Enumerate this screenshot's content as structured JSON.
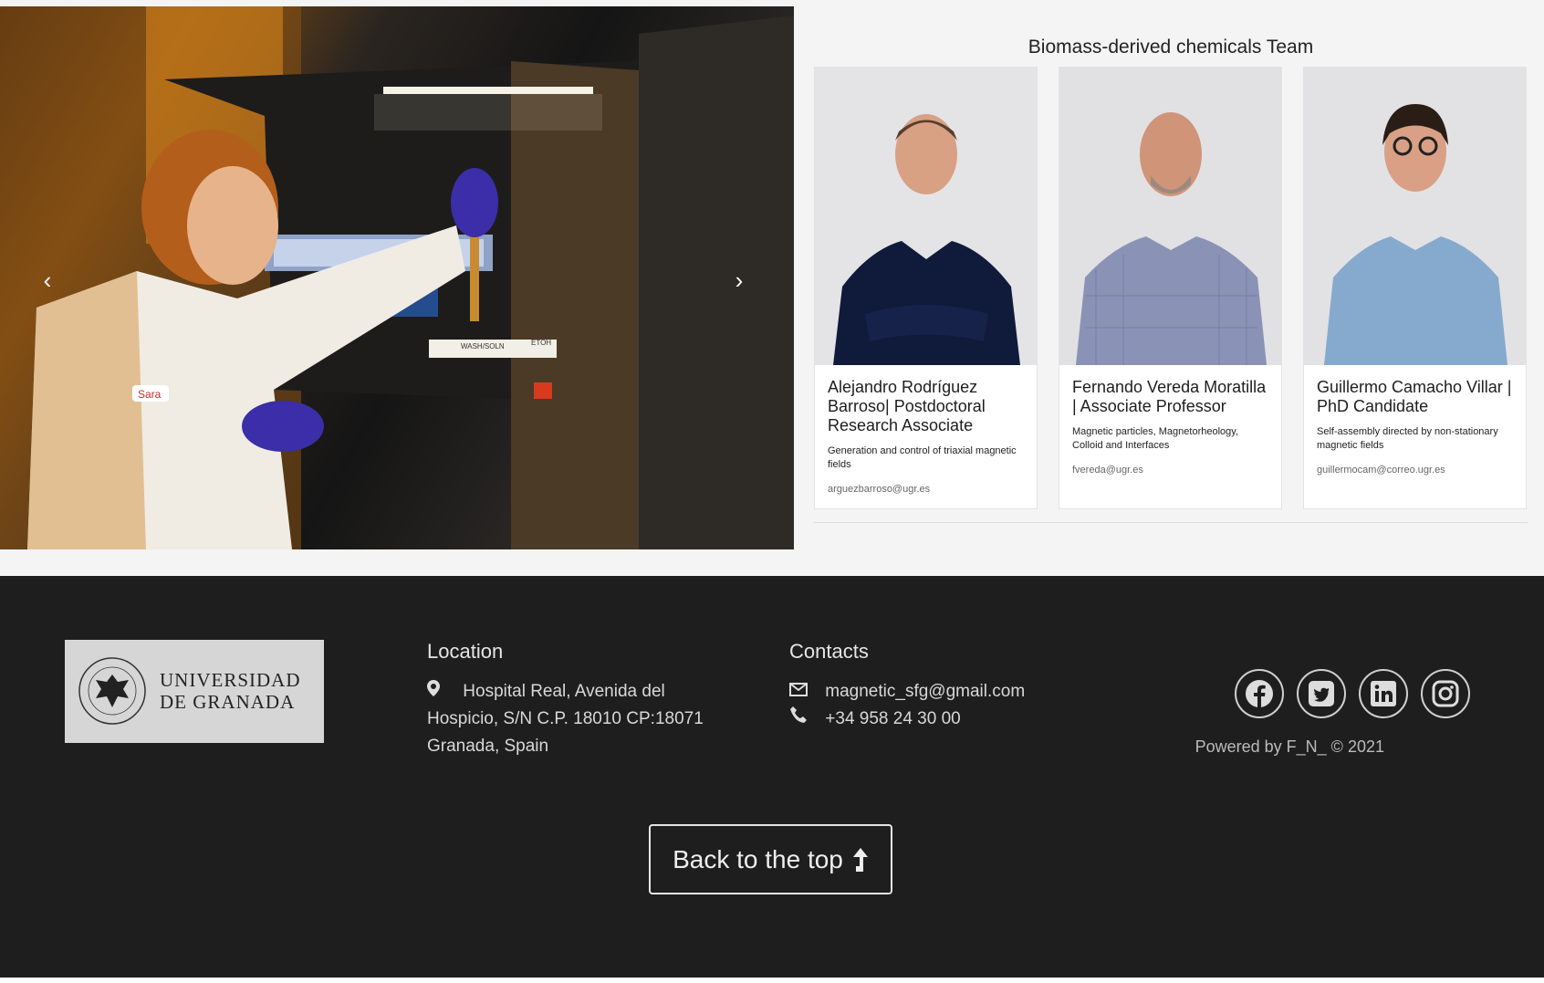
{
  "team": {
    "title": "Biomass-derived chemicals Team",
    "members": [
      {
        "name": "Alejandro Rodríguez Barroso| Postdoctoral Research Associate",
        "description": "Generation and control of triaxial magnetic fields",
        "email": "arguezbarroso@ugr.es"
      },
      {
        "name": "Fernando Vereda Moratilla | Associate Professor",
        "description": "Magnetic particles, Magnetorheology, Colloid and Interfaces",
        "email": "fvereda@ugr.es"
      },
      {
        "name": "Guillermo Camacho Villar | PhD Candidate",
        "description": "Self-assembly directed by non-stationary magnetic fields",
        "email": "guillermocam@correo.ugr.es"
      }
    ]
  },
  "carousel": {
    "prev_icon": "chevron-left-icon",
    "next_icon": "chevron-right-icon",
    "prev_glyph": "‹",
    "next_glyph": "›",
    "labels": [
      "Sara",
      "WASH/SOLN",
      "ETOH"
    ]
  },
  "footer": {
    "logo": {
      "line1": "UNIVERSIDAD",
      "line2": "DE GRANADA"
    },
    "location": {
      "title": "Location",
      "address": "Hospital Real, Avenida del Hospicio, S/N C.P. 18010 CP:18071 Granada, Spain"
    },
    "contacts": {
      "title": "Contacts",
      "email": "magnetic_sfg@gmail.com",
      "phone": "+34 958 24 30 00"
    },
    "socials": [
      "facebook-icon",
      "twitter-icon",
      "linkedin-icon",
      "instagram-icon"
    ],
    "powered": "Powered by F_N_ © 2021",
    "back_to_top": "Back to the top"
  },
  "colors": {
    "footer_bg": "#1e1e1e",
    "page_bg": "#f4f4f4",
    "card_bg": "#ffffff"
  }
}
